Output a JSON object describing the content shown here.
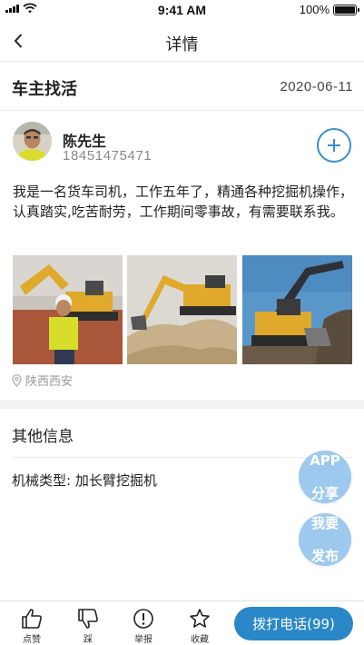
{
  "status_bar": {
    "time": "9:41 AM",
    "battery": "100%"
  },
  "nav": {
    "title": "详情"
  },
  "post": {
    "title": "车主找活",
    "date": "2020-06-11",
    "description": "我是一名货车司机，工作五年了，精通各种挖掘机操作，认真踏实,吃苦耐劳，工作期间零事故，有需要联系我。",
    "location": "陕西西安"
  },
  "user": {
    "name": "陈先生",
    "phone": "18451475471"
  },
  "other_info": {
    "title": "其他信息",
    "label": "机械类型",
    "separator": ":",
    "value": "加长臂挖掘机"
  },
  "floating": {
    "share_line1": "APP",
    "share_line2": "分享",
    "publish_line1": "我要",
    "publish_line2": "发布"
  },
  "bottom": {
    "like": "点赞",
    "dislike": "踩",
    "report": "举报",
    "favorite": "收藏",
    "call_label": "拨打电话",
    "call_count": "(99)"
  },
  "colors": {
    "accent": "#2a88c9",
    "floating": "#9ec9ee",
    "excavator": "#e0a92b"
  },
  "icons": [
    "back-icon",
    "plus-icon",
    "location-pin-icon",
    "thumbs-up-icon",
    "thumbs-down-icon",
    "report-icon",
    "star-icon"
  ]
}
